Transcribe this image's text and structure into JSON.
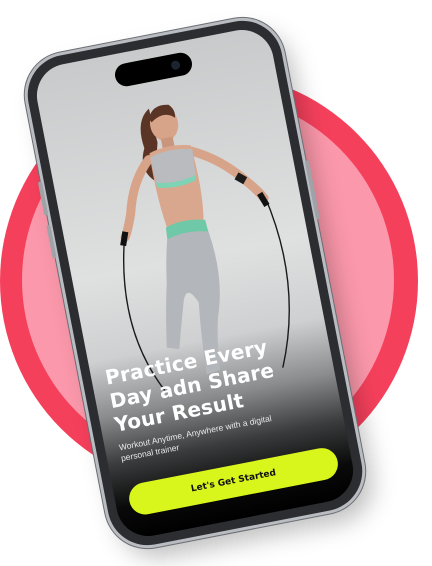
{
  "onboarding": {
    "headline": "Practice Every Day adn Share Your Result",
    "subtitle": "Workout Anytime, Anywhere with a digital personal trainer",
    "cta_label": "Let's Get Started"
  },
  "colors": {
    "ring": "#f5405c",
    "ring_inner": "#fb98ab",
    "cta_background": "#d8f51c",
    "phone_frame": "#2b2d30"
  },
  "icons": [
    "camera-icon"
  ]
}
